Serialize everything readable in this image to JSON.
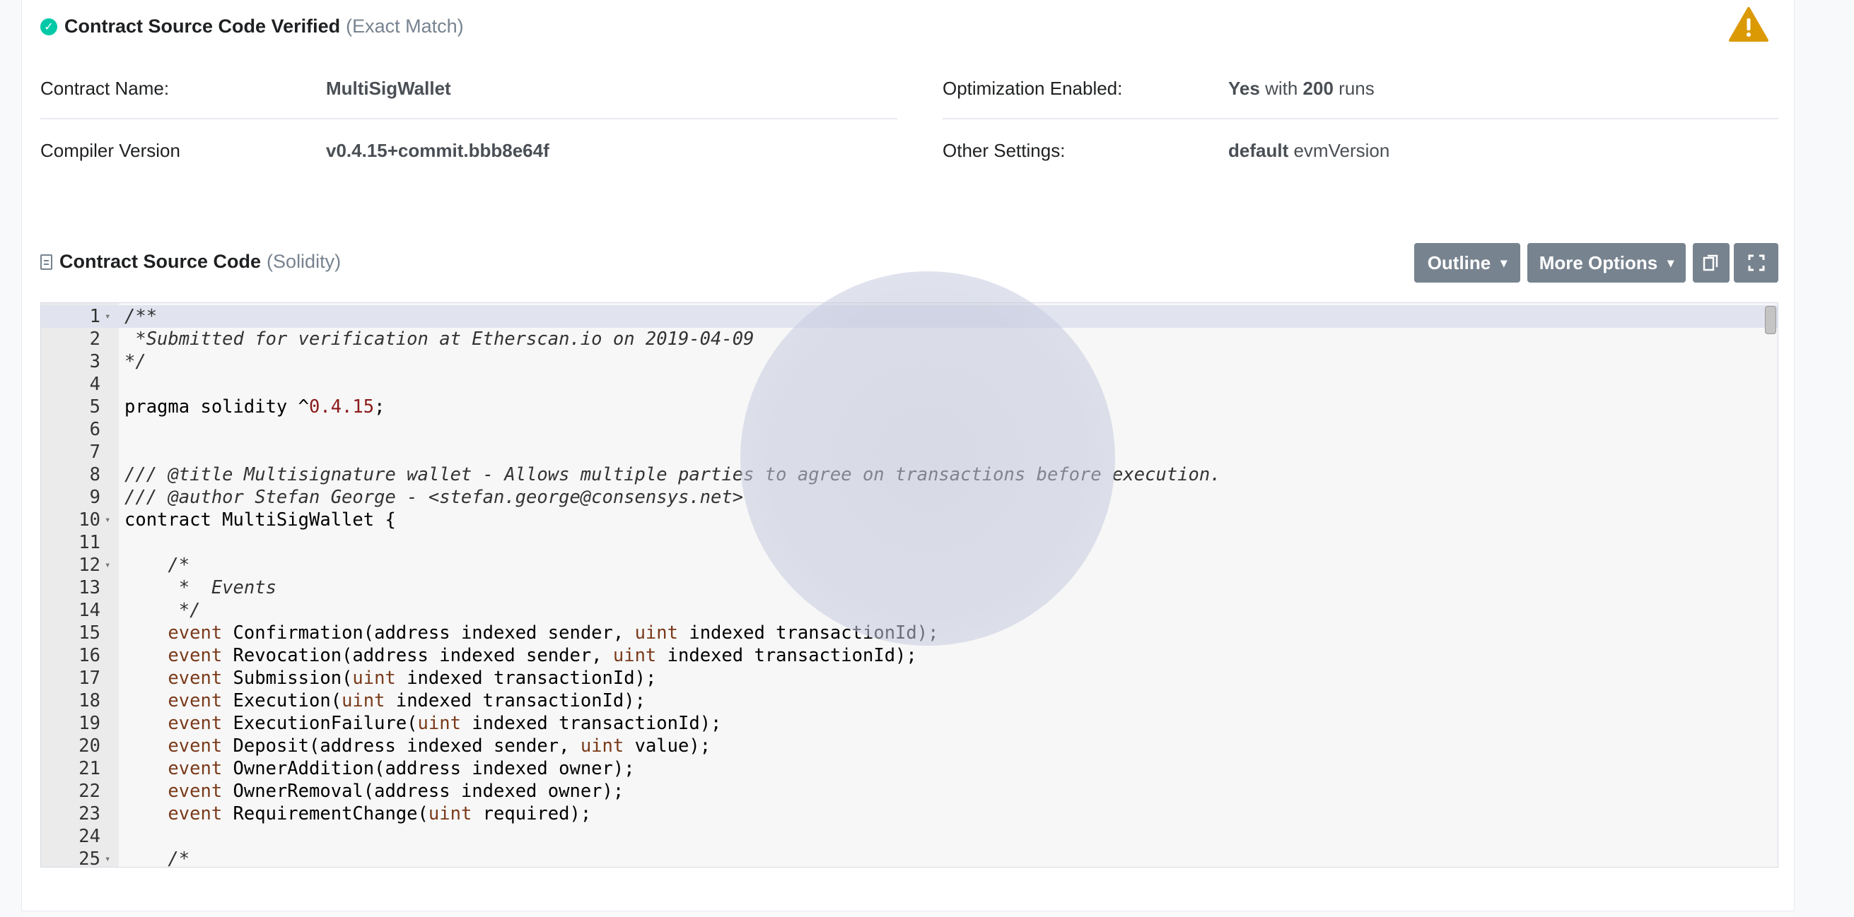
{
  "verified": {
    "title": "Contract Source Code Verified",
    "subtitle": "(Exact Match)"
  },
  "warning_icon": "warning-icon",
  "info": {
    "contract_name_label": "Contract Name:",
    "contract_name_value": "MultiSigWallet",
    "compiler_label": "Compiler Version",
    "compiler_value": "v0.4.15+commit.bbb8e64f",
    "optimization_label": "Optimization Enabled:",
    "optimization_yes": "Yes",
    "optimization_with": "with",
    "optimization_runs": "200",
    "optimization_runs_word": "runs",
    "other_label": "Other Settings:",
    "other_default": "default",
    "other_evm": "evmVersion"
  },
  "source": {
    "title": "Contract Source Code",
    "language": "(Solidity)",
    "outline_label": "Outline",
    "more_options_label": "More Options",
    "copy_icon": "copy-icon",
    "fullscreen_icon": "fullscreen-icon"
  },
  "code_lines": [
    {
      "n": "1",
      "fold": true,
      "html": "<span class='cmt'>/**</span>"
    },
    {
      "n": "2",
      "fold": false,
      "html": "<span class='cmt'> *Submitted for verification at Etherscan.io on 2019-04-09</span>"
    },
    {
      "n": "3",
      "fold": false,
      "html": "<span class='cmt'>*/</span>"
    },
    {
      "n": "4",
      "fold": false,
      "html": ""
    },
    {
      "n": "5",
      "fold": false,
      "html": "pragma solidity ^<span class='num'>0.4.15</span>;"
    },
    {
      "n": "6",
      "fold": false,
      "html": ""
    },
    {
      "n": "7",
      "fold": false,
      "html": ""
    },
    {
      "n": "8",
      "fold": false,
      "html": "<span class='cmt'>/// @title Multisignature wallet - Allows multiple parties to agree on transactions before execution.</span>"
    },
    {
      "n": "9",
      "fold": false,
      "html": "<span class='cmt'>/// @author Stefan George - &lt;stefan.george@consensys.net&gt;</span>"
    },
    {
      "n": "10",
      "fold": true,
      "html": "contract MultiSigWallet {"
    },
    {
      "n": "11",
      "fold": false,
      "html": ""
    },
    {
      "n": "12",
      "fold": true,
      "html": "    <span class='cmt'>/*</span>"
    },
    {
      "n": "13",
      "fold": false,
      "html": "<span class='cmt'>     *  Events</span>"
    },
    {
      "n": "14",
      "fold": false,
      "html": "<span class='cmt'>     */</span>"
    },
    {
      "n": "15",
      "fold": false,
      "html": "    <span class='kw'>event</span> Confirmation(address indexed sender, <span class='kw'>uint</span> indexed transactionId);"
    },
    {
      "n": "16",
      "fold": false,
      "html": "    <span class='kw'>event</span> Revocation(address indexed sender, <span class='kw'>uint</span> indexed transactionId);"
    },
    {
      "n": "17",
      "fold": false,
      "html": "    <span class='kw'>event</span> Submission(<span class='kw'>uint</span> indexed transactionId);"
    },
    {
      "n": "18",
      "fold": false,
      "html": "    <span class='kw'>event</span> Execution(<span class='kw'>uint</span> indexed transactionId);"
    },
    {
      "n": "19",
      "fold": false,
      "html": "    <span class='kw'>event</span> ExecutionFailure(<span class='kw'>uint</span> indexed transactionId);"
    },
    {
      "n": "20",
      "fold": false,
      "html": "    <span class='kw'>event</span> Deposit(address indexed sender, <span class='kw'>uint</span> value);"
    },
    {
      "n": "21",
      "fold": false,
      "html": "    <span class='kw'>event</span> OwnerAddition(address indexed owner);"
    },
    {
      "n": "22",
      "fold": false,
      "html": "    <span class='kw'>event</span> OwnerRemoval(address indexed owner);"
    },
    {
      "n": "23",
      "fold": false,
      "html": "    <span class='kw'>event</span> RequirementChange(<span class='kw'>uint</span> required);"
    },
    {
      "n": "24",
      "fold": false,
      "html": ""
    },
    {
      "n": "25",
      "fold": true,
      "html": "    <span class='cmt'>/*</span>"
    }
  ]
}
